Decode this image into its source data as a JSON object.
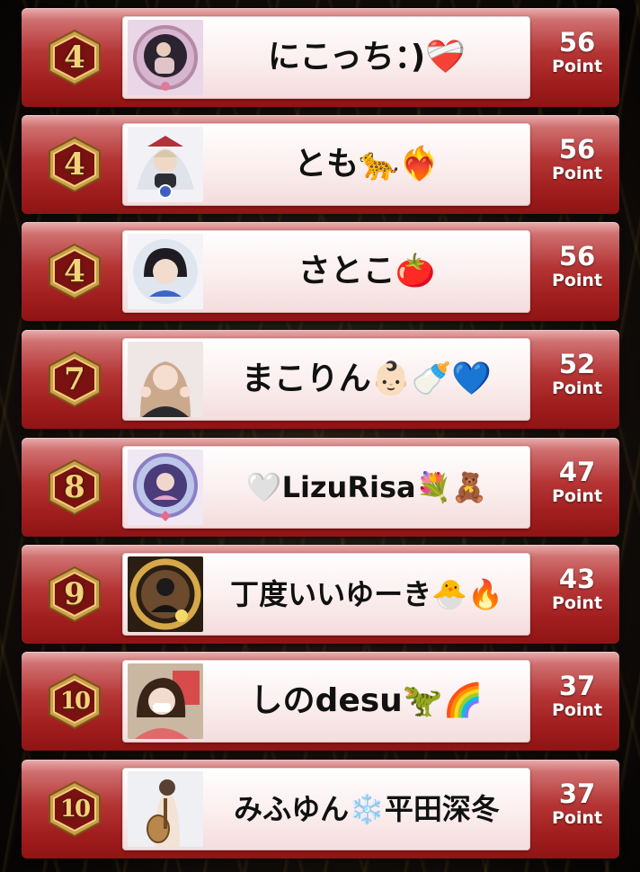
{
  "colors": {
    "row_top": "#d07070",
    "row_bottom": "#8f1414",
    "badge_gold": "#f3d27a",
    "badge_dark": "#6e1010",
    "score_text": "#ffffff"
  },
  "unit_label": "Point",
  "entries": [
    {
      "rank": "4",
      "name": "にこっち：)❤️‍🩹",
      "points": "56",
      "unit": "Point",
      "avatar": "avatar-photo"
    },
    {
      "rank": "4",
      "name": "とも🐆❤️‍🔥",
      "points": "56",
      "unit": "Point",
      "avatar": "avatar-photo"
    },
    {
      "rank": "4",
      "name": "さとこ🍅",
      "points": "56",
      "unit": "Point",
      "avatar": "avatar-photo"
    },
    {
      "rank": "7",
      "name": "まこりん👶🏻🍼💙",
      "points": "52",
      "unit": "Point",
      "avatar": "avatar-photo"
    },
    {
      "rank": "8",
      "name": "🤍LizuRisa💐🧸",
      "points": "47",
      "unit": "Point",
      "avatar": "avatar-photo"
    },
    {
      "rank": "9",
      "name": "丁度いいゆーき🐣🔥",
      "points": "43",
      "unit": "Point",
      "avatar": "avatar-photo"
    },
    {
      "rank": "10",
      "name": "しのdesu🦖🌈",
      "points": "37",
      "unit": "Point",
      "avatar": "avatar-photo"
    },
    {
      "rank": "10",
      "name": "みふゆん❄️平田深冬",
      "points": "37",
      "unit": "Point",
      "avatar": "avatar-photo"
    }
  ]
}
